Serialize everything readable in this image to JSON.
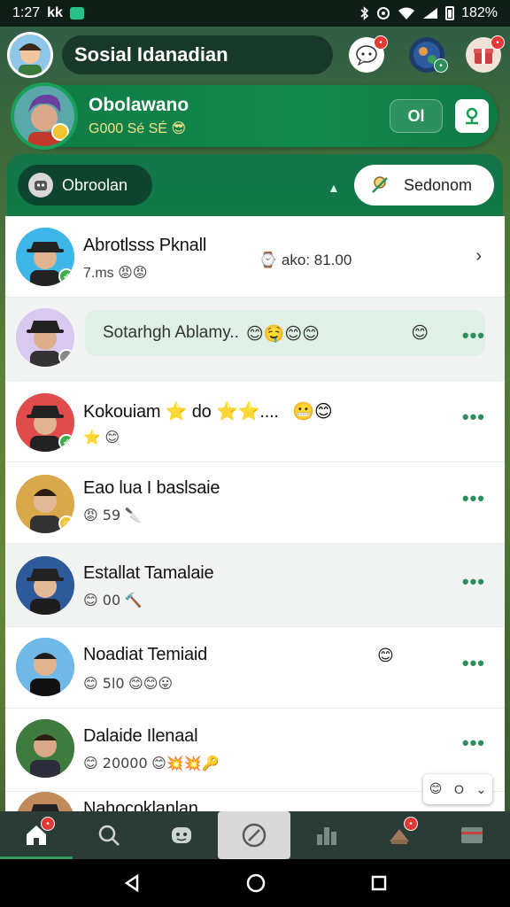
{
  "status_bar": {
    "time": "1:27",
    "left_extra": "kk",
    "battery": "182%"
  },
  "header": {
    "title": "Sosial Idanadian"
  },
  "profile_banner": {
    "name": "Obolawano",
    "subtitle": "G000 Sé SÉ",
    "subtitle_emoji": "😎",
    "button_label": "Ol"
  },
  "tabs": {
    "left_label": "Obroolan",
    "right_label": "Sedonom"
  },
  "chats": [
    {
      "name": "Abrotlsss Pknall",
      "sub": "7.ms",
      "sub_emojis": "😡😡",
      "meta": "ako: 81.00",
      "badge": "✓"
    },
    {
      "bubble": "Sotarhgh Ablamy..",
      "bubble_emojis": "😊🤤😊😊",
      "trail": "😊"
    },
    {
      "name": "Kokouiam ⭐ do ⭐⭐....",
      "name_trail": "😬😊",
      "sub": "⭐",
      "sub_emojis": "😊",
      "badge": "✓"
    },
    {
      "name": "Eao lua I baslsaie",
      "sub": "😡 59",
      "sub_emojis": "🔪",
      "badge": "☺"
    },
    {
      "name": "Estallat Tamalaie",
      "sub": "😊 00",
      "sub_emojis": "🔨"
    },
    {
      "name": "Noadiat Temiaid",
      "sub": "😊 5l0",
      "sub_emojis": "😊😊😛",
      "trail": "😊"
    },
    {
      "name": "Dalaide Ilenaal",
      "sub": "😊 20000",
      "sub_emojis": "😊💥💥🔑"
    },
    {
      "name": "Nahocoklanlan"
    }
  ],
  "float_chip": {
    "label": "O"
  },
  "colors": {
    "brand_green": "#0f7a45",
    "more_dots": "#2a8f5a",
    "badge_red": "#e53935",
    "nav_bg": "#2b3b35"
  },
  "icons": {
    "nav": [
      "home-icon",
      "search-icon",
      "game-icon",
      "compass-icon",
      "stats-icon",
      "gift-icon",
      "wallet-icon"
    ]
  }
}
